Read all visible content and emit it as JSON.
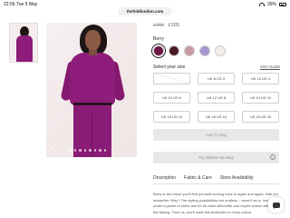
{
  "status_bar": {
    "time": "22:56",
    "date": "Tue 5 May",
    "battery": "39%"
  },
  "browser": {
    "url": "thefoldlondon.com"
  },
  "product": {
    "price_original": "£250",
    "price_sale": "£185",
    "color_name": "Berry",
    "swatches": [
      {
        "name": "berry",
        "color": "#6e1448",
        "selected": true
      },
      {
        "name": "burgundy",
        "color": "#4a1a24",
        "selected": false
      },
      {
        "name": "mauve",
        "color": "#c99aa0",
        "selected": false
      },
      {
        "name": "lilac",
        "color": "#a895cf",
        "selected": false
      },
      {
        "name": "ivory",
        "color": "#f1efe8",
        "selected": false
      }
    ],
    "size_label": "Select your size",
    "size_guide": "Size Guide",
    "sizes": [
      {
        "label": "",
        "available": false
      },
      {
        "label": "UK 8 US 3",
        "available": true
      },
      {
        "label": "UK 10 US 4",
        "available": true
      },
      {
        "label": "UK 12 US 6",
        "available": true
      },
      {
        "label": "UK 12 US 8",
        "available": true
      },
      {
        "label": "UK 14 US 10",
        "available": true
      },
      {
        "label": "UK 16 US 12",
        "available": true
      },
      {
        "label": "UK 18 US 14",
        "available": true
      },
      {
        "label": "UK 20 US 16",
        "available": true
      }
    ],
    "add_to_bag": "Add To Bag",
    "try_before": "Try Before You Buy",
    "tabs": [
      "Description",
      "Fabric & Care",
      "Store Availability"
    ],
    "description": "Berry is the brave you'll find yourself coming back to again and again, with our bestseller. Why? The styling possibilities are endless – wear it as is, loose, under a jacket or shirts and let its sleek silhouette and expert stretch silk do the talking. Trust us, you'll want this bestseller in every colour."
  },
  "icons": {
    "expand": "expand-icon",
    "chat": "chat-icon",
    "info": "info-icon"
  },
  "gallery": {
    "image_count": 8,
    "active_index": 0
  }
}
